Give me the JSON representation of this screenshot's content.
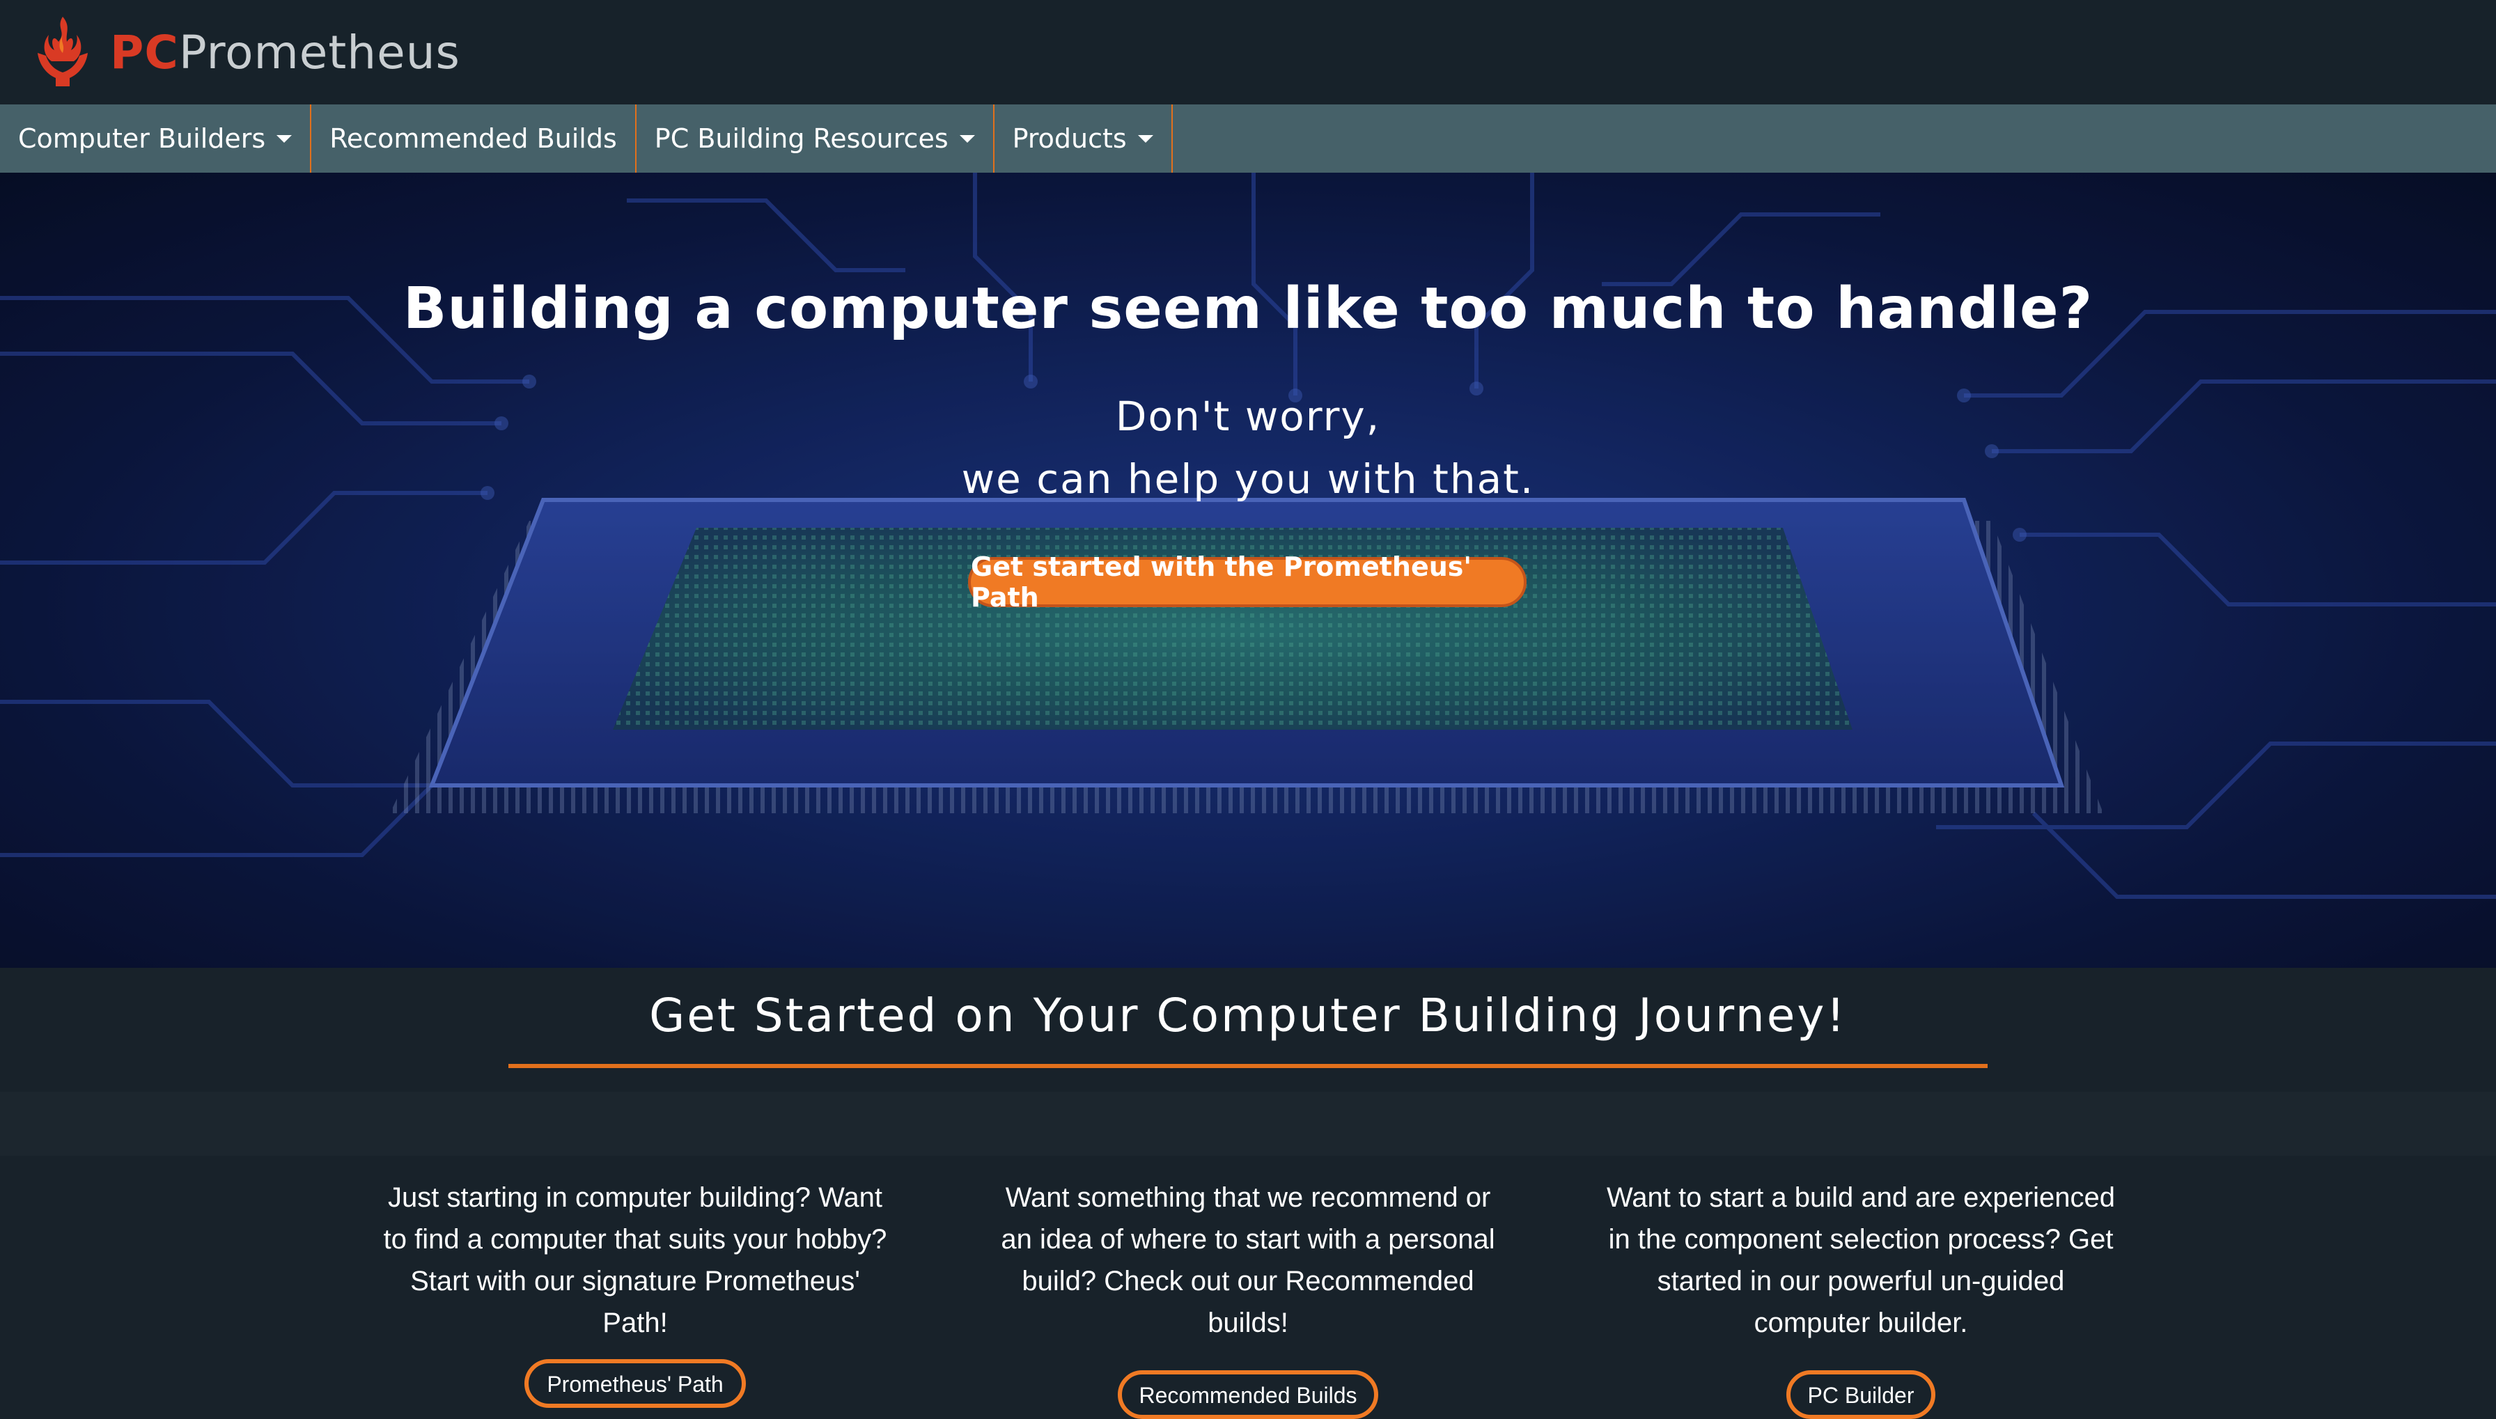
{
  "brand": {
    "prefix": "PC",
    "name": "Prometheus"
  },
  "nav": [
    {
      "label": "Computer Builders",
      "dropdown": true
    },
    {
      "label": "Recommended Builds",
      "dropdown": false
    },
    {
      "label": "PC Building Resources",
      "dropdown": true
    },
    {
      "label": "Products",
      "dropdown": true
    }
  ],
  "hero": {
    "title": "Building a computer seem like too much to handle?",
    "line1": "Don't worry,",
    "line2": "we can help you with that.",
    "cta": "Get started with the Prometheus' Path"
  },
  "section": {
    "title": "Get Started on Your Computer Building Journey!"
  },
  "cards": [
    {
      "text": "Just starting in computer building? Want to find a computer that suits your hobby? Start with our signature Prometheus' Path!",
      "button": "Prometheus' Path"
    },
    {
      "text": "Want something that we recommend or an idea of where to start with a personal build? Check out our Recommended builds!",
      "button": "Recommended Builds"
    },
    {
      "text": "Want to start a build and are experienced in the component selection process? Get started in our powerful un-guided computer builder.",
      "button": "PC Builder"
    }
  ],
  "colors": {
    "accent": "#f07a24",
    "nav_background": "#466169",
    "page_background": "#18222a",
    "brand_red": "#d93a24"
  },
  "icons": {
    "logo": "flame-hands-icon",
    "dropdown": "caret-down-icon"
  }
}
